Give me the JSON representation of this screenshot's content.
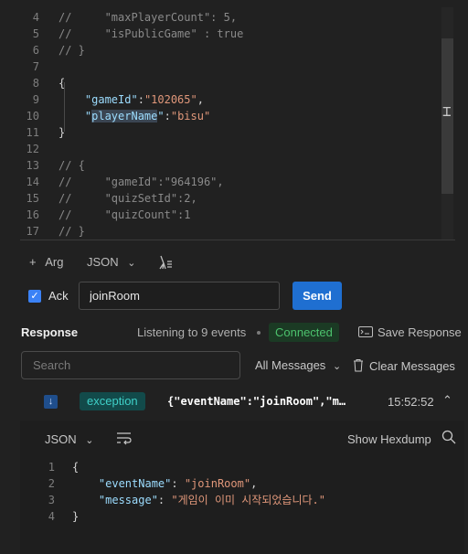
{
  "editor": {
    "lines": [
      {
        "n": "4",
        "parts": [
          {
            "c": "cmt",
            "t": "//     \"maxPlayerCount\": 5,"
          }
        ]
      },
      {
        "n": "5",
        "parts": [
          {
            "c": "cmt",
            "t": "//     \"isPublicGame\" : true"
          }
        ]
      },
      {
        "n": "6",
        "parts": [
          {
            "c": "cmt",
            "t": "// }"
          }
        ]
      },
      {
        "n": "7",
        "parts": []
      },
      {
        "n": "8",
        "parts": [
          {
            "c": "brk",
            "t": "{"
          }
        ]
      },
      {
        "n": "9",
        "parts": [
          {
            "c": "key",
            "t": "    \"gameId\""
          },
          {
            "c": "brk",
            "t": ":"
          },
          {
            "c": "str",
            "t": "\"102065\""
          },
          {
            "c": "brk",
            "t": ","
          }
        ]
      },
      {
        "n": "10",
        "parts": [
          {
            "c": "key",
            "t": "    \""
          },
          {
            "c": "key hl",
            "t": "playerName"
          },
          {
            "c": "key",
            "t": "\""
          },
          {
            "c": "brk",
            "t": ":"
          },
          {
            "c": "str",
            "t": "\"bisu\""
          }
        ]
      },
      {
        "n": "11",
        "parts": [
          {
            "c": "brk",
            "t": "}"
          }
        ]
      },
      {
        "n": "12",
        "parts": []
      },
      {
        "n": "13",
        "parts": [
          {
            "c": "cmt",
            "t": "// {"
          }
        ]
      },
      {
        "n": "14",
        "parts": [
          {
            "c": "cmt",
            "t": "//     \"gameId\":\"964196\","
          }
        ]
      },
      {
        "n": "15",
        "parts": [
          {
            "c": "cmt",
            "t": "//     \"quizSetId\":2,"
          }
        ]
      },
      {
        "n": "16",
        "parts": [
          {
            "c": "cmt",
            "t": "//     \"quizCount\":1"
          }
        ]
      },
      {
        "n": "17",
        "parts": [
          {
            "c": "cmt",
            "t": "// }"
          }
        ]
      }
    ]
  },
  "toolbar": {
    "add_arg": "Arg",
    "format": "JSON",
    "ack_label": "Ack",
    "event_name": "joinRoom",
    "send": "Send"
  },
  "response": {
    "title": "Response",
    "listening": "Listening to 9 events",
    "status": "Connected",
    "save": "Save Response",
    "search_placeholder": "Search",
    "filter": "All Messages",
    "clear": "Clear Messages",
    "event": {
      "type": "exception",
      "preview": "{\"eventName\":\"joinRoom\",\"m…",
      "time": "15:52:52"
    },
    "detail": {
      "format": "JSON",
      "hexdump": "Show Hexdump",
      "lines": [
        {
          "n": "1",
          "parts": [
            {
              "c": "brk",
              "t": "{"
            }
          ]
        },
        {
          "n": "2",
          "parts": [
            {
              "c": "key",
              "t": "    \"eventName\""
            },
            {
              "c": "brk",
              "t": ": "
            },
            {
              "c": "str",
              "t": "\"joinRoom\""
            },
            {
              "c": "brk",
              "t": ","
            }
          ]
        },
        {
          "n": "3",
          "parts": [
            {
              "c": "key",
              "t": "    \"message\""
            },
            {
              "c": "brk",
              "t": ": "
            },
            {
              "c": "str",
              "t": "\"게임이 이미 시작되었습니다.\""
            }
          ]
        },
        {
          "n": "4",
          "parts": [
            {
              "c": "brk",
              "t": "}"
            }
          ]
        }
      ]
    }
  },
  "colors": {
    "accent": "#1f6fd1",
    "connected": "#4cc26d",
    "exception": "#3fd0c8"
  }
}
